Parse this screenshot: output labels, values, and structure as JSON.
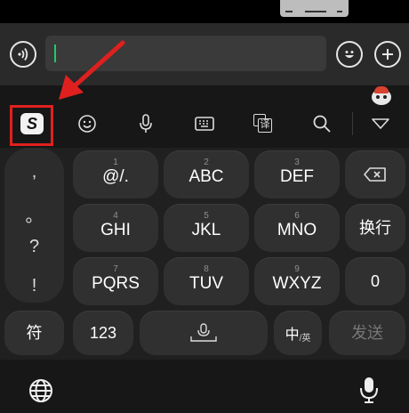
{
  "input_bar": {
    "voice_button_icon": "voice-wave-icon",
    "text_value": "",
    "emoji_button_icon": "smiley-icon",
    "plus_button_icon": "plus-icon"
  },
  "toolbar": {
    "logo_letter": "S",
    "items": [
      "sogou-logo",
      "emoji-icon",
      "microphone-icon",
      "keyboard-icon",
      "translate-icon",
      "search-icon",
      "collapse-triangle-icon"
    ],
    "translate_glyph": "译",
    "highlight_color": "#e0201e"
  },
  "punctuation": [
    ",",
    "。",
    "?",
    "!"
  ],
  "keys": {
    "row1": [
      {
        "num": "1",
        "label": "@/."
      },
      {
        "num": "2",
        "label": "ABC"
      },
      {
        "num": "3",
        "label": "DEF"
      }
    ],
    "row2": [
      {
        "num": "4",
        "label": "GHI"
      },
      {
        "num": "5",
        "label": "JKL"
      },
      {
        "num": "6",
        "label": "MNO"
      }
    ],
    "row3": [
      {
        "num": "7",
        "label": "PQRS"
      },
      {
        "num": "8",
        "label": "TUV"
      },
      {
        "num": "9",
        "label": "WXYZ"
      }
    ],
    "newline": "换行",
    "zero": "0",
    "symbols": "符",
    "numbers": "123",
    "lang_main": "中",
    "lang_sub": "/英",
    "send": "发送"
  },
  "bottom_bar": {
    "left_icon": "globe-icon",
    "right_icon": "microphone-icon"
  }
}
